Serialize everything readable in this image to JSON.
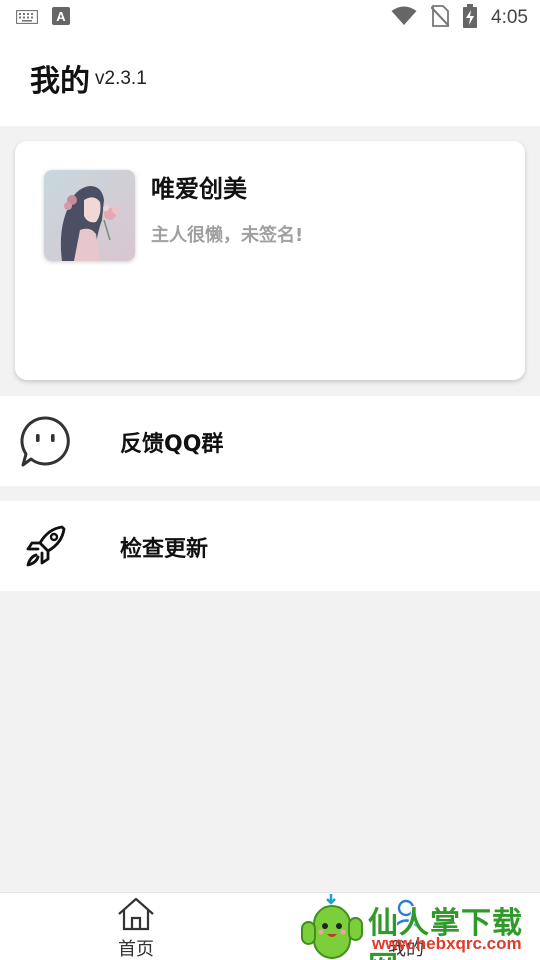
{
  "status_bar": {
    "time": "4:05",
    "icons": [
      "keyboard-icon",
      "a-notification-icon",
      "wifi-icon",
      "no-sim-icon",
      "battery-charging-icon"
    ]
  },
  "header": {
    "title": "我的",
    "version": "v2.3.1"
  },
  "profile": {
    "name": "唯爱创美",
    "signature": "主人很懒，未签名!"
  },
  "menu": [
    {
      "label": "反馈QQ群",
      "icon": "chat-bubble-icon"
    },
    {
      "label": "检查更新",
      "icon": "rocket-icon"
    }
  ],
  "bottom_nav": [
    {
      "label": "首页",
      "icon": "home-icon"
    },
    {
      "label": "我的",
      "icon": "user-icon"
    }
  ],
  "watermark": {
    "text": "仙人掌下载网",
    "url": "www.hebxqrc.com"
  },
  "colors": {
    "background": "#f2f2f2",
    "card": "#ffffff",
    "signature_gray": "#a0a0a0",
    "watermark_green": "#2f9a2a",
    "watermark_red": "#e23b2a"
  }
}
